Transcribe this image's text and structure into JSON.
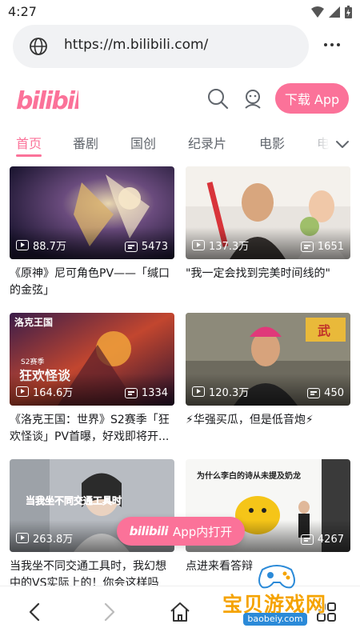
{
  "status_bar": {
    "time": "4:27"
  },
  "browser": {
    "url": "https://m.bilibili.com/"
  },
  "header": {
    "logo_text": "bilibili",
    "download_label": "下载 App"
  },
  "tabs": [
    "首页",
    "番剧",
    "国创",
    "纪录片",
    "电影",
    "电"
  ],
  "cards": [
    {
      "views": "88.7万",
      "danmaku": "5473",
      "title": "《原神》尼可角色PV——「缄口的金弦」"
    },
    {
      "views": "137.3万",
      "danmaku": "1651",
      "title": "\"我一定会找到完美时间线的\""
    },
    {
      "views": "164.6万",
      "danmaku": "1334",
      "title": "《洛克王国：世界》S2赛季「狂欢怪谈」PV首曝，好戏即将开..."
    },
    {
      "views": "120.3万",
      "danmaku": "450",
      "title": "⚡华强买瓜，但是低音炮⚡"
    },
    {
      "views": "263.8万",
      "danmaku": "",
      "title": "当我坐不同交通工具时，我幻想中的VS实际上的！你会这样吗"
    },
    {
      "views": "",
      "danmaku": "4267",
      "title": "点进来看答辩"
    }
  ],
  "thumb_text": {
    "card3_overlay": "洛克王国",
    "card3_season": "S2赛季",
    "card3_art_title": "狂欢怪谈",
    "card4_sign": "武",
    "card5_caption": "当我坐不同交通工具时",
    "card6_slide": "为什么李白的诗从未提及奶龙"
  },
  "open_app": {
    "logo": "bilibili",
    "label": "App内打开"
  },
  "watermark": {
    "text": "宝贝游戏网",
    "url": "baobeiy.com"
  },
  "colors": {
    "brand_pink": "#fb7299",
    "text_primary": "#18191c",
    "text_secondary": "#61666d"
  }
}
